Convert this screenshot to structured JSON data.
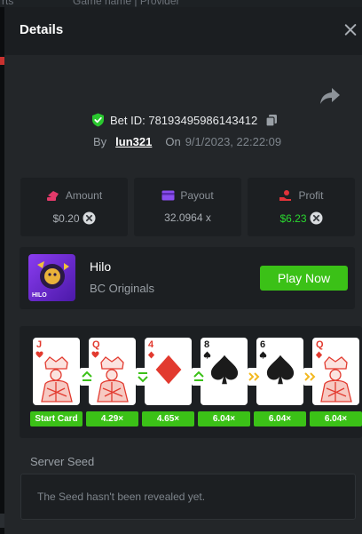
{
  "backdrop": {
    "left_text": "rts",
    "right_text": "Game name | Provider"
  },
  "modal": {
    "title": "Details",
    "close_icon": "close-icon"
  },
  "bet": {
    "id_text": "Bet ID: 78193495986143412",
    "by_label": "By",
    "user": "lun321",
    "on_label": "On",
    "date": "9/1/2023, 22:22:09",
    "verified_icon": "shield-check-icon",
    "copy_icon": "copy-icon",
    "share_icon": "share-icon"
  },
  "stats": {
    "amount": {
      "label": "Amount",
      "value": "$0.20",
      "icon": "coins-icon"
    },
    "payout": {
      "label": "Payout",
      "value": "32.0964 x",
      "icon": "card-icon"
    },
    "profit": {
      "label": "Profit",
      "value": "$6.23",
      "icon": "profit-hand-icon"
    }
  },
  "game": {
    "name": "Hilo",
    "provider": "BC Originals",
    "thumb_text": "HILO",
    "play_label": "Play Now"
  },
  "cards": [
    {
      "rank": "J",
      "suit": "heart",
      "color": "red",
      "mult": "Start Card"
    },
    {
      "rank": "Q",
      "suit": "heart",
      "color": "red",
      "mult": "4.29×",
      "action": "higher"
    },
    {
      "rank": "4",
      "suit": "diamond",
      "color": "red",
      "mult": "4.65×",
      "action": "lower"
    },
    {
      "rank": "8",
      "suit": "spade",
      "color": "black",
      "mult": "6.04×",
      "action": "higher"
    },
    {
      "rank": "6",
      "suit": "spade",
      "color": "black",
      "mult": "6.04×",
      "action": "skip"
    },
    {
      "rank": "Q",
      "suit": "diamond",
      "color": "red",
      "mult": "6.04×",
      "action": "skip"
    }
  ],
  "seed": {
    "label": "Server Seed",
    "message": "The Seed hasn't been revealed yet."
  },
  "colors": {
    "accent_green": "#3bc117",
    "profit_green": "#2ad62f",
    "card_red": "#e23a2f",
    "panel": "#1c1f22",
    "modal": "#232629"
  }
}
